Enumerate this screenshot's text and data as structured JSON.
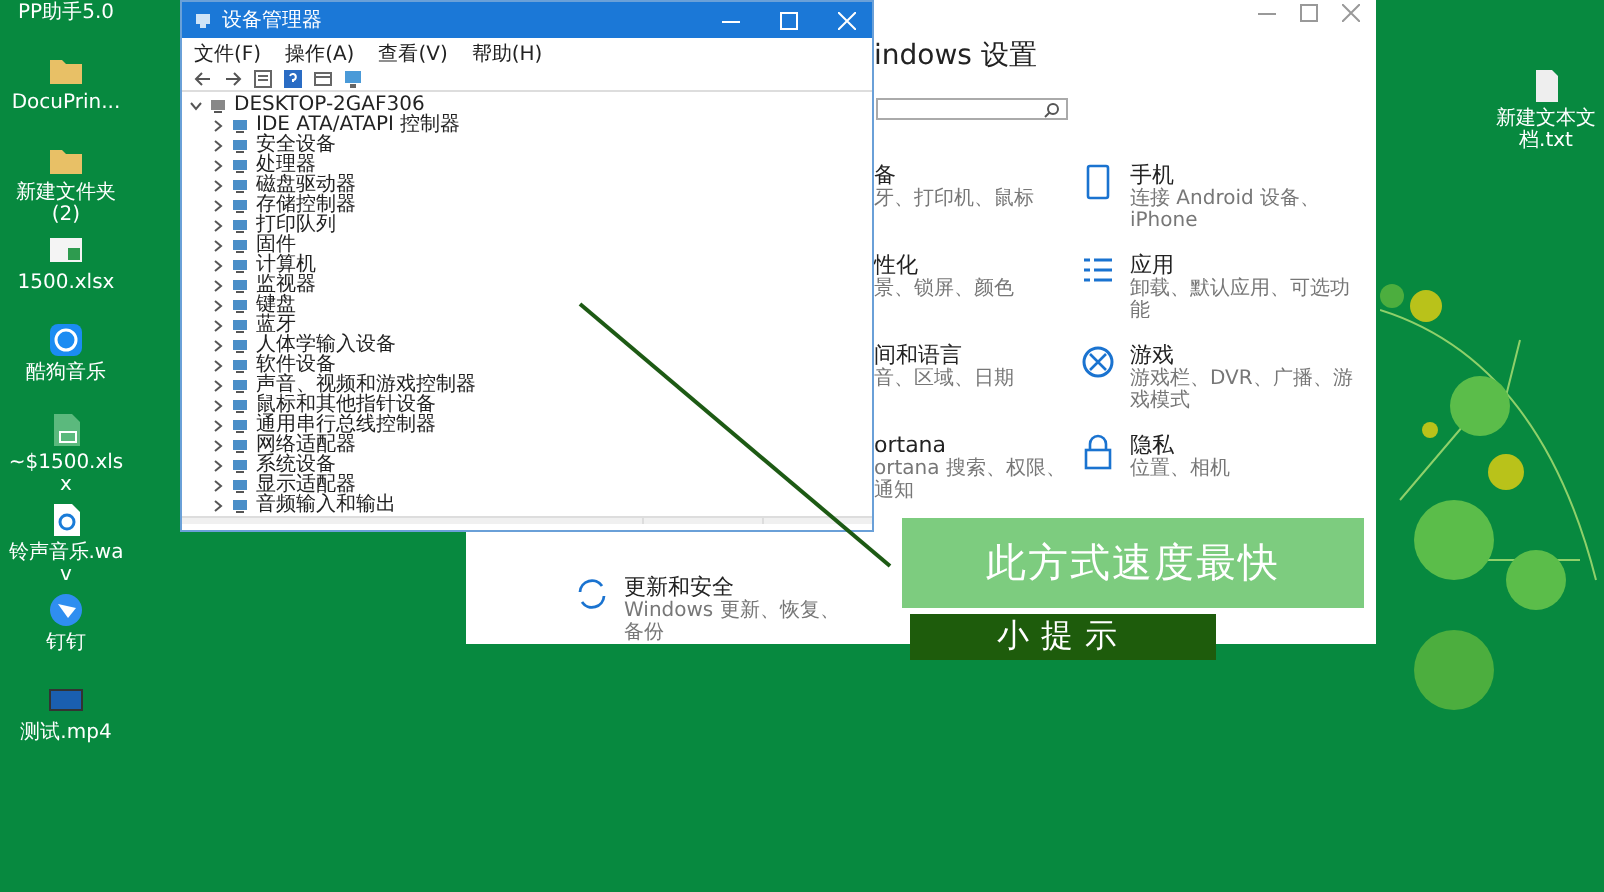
{
  "desktop_icons": [
    {
      "label": "PP助手5.0",
      "kind": "app"
    },
    {
      "label": "DocuPrin...",
      "kind": "folder"
    },
    {
      "label": "新建文件夹(2)",
      "kind": "folder"
    },
    {
      "label": "1500.xlsx",
      "kind": "sheet"
    },
    {
      "label": "酷狗音乐",
      "kind": "music"
    },
    {
      "label": "~$1500.xlsx",
      "kind": "excel"
    },
    {
      "label": "铃声音乐.wav",
      "kind": "audio"
    },
    {
      "label": "钉钉",
      "kind": "chat"
    },
    {
      "label": "测试.mp4",
      "kind": "video"
    }
  ],
  "desktop_icon_right": {
    "label": "新建文本文档.txt",
    "kind": "text"
  },
  "settings_window": {
    "title": "indows 设置",
    "tiles": [
      {
        "title": "备",
        "subtitle": "牙、打印机、鼠标",
        "kind": "covered"
      },
      {
        "title": "手机",
        "subtitle": "连接 Android 设备、iPhone",
        "kind": "phone"
      },
      {
        "title": "性化",
        "subtitle": "景、锁屏、颜色",
        "kind": "covered"
      },
      {
        "title": "应用",
        "subtitle": "卸载、默认应用、可选功能",
        "kind": "apps"
      },
      {
        "title": "间和语言",
        "subtitle": "音、区域、日期",
        "kind": "covered"
      },
      {
        "title": "游戏",
        "subtitle": "游戏栏、DVR、广播、游戏模式",
        "kind": "game"
      },
      {
        "title": "ortana",
        "subtitle": "ortana 搜索、权限、通知",
        "kind": "covered"
      },
      {
        "title": "隐私",
        "subtitle": "位置、相机",
        "kind": "privacy"
      }
    ],
    "bottom_tile": {
      "title": "更新和安全",
      "subtitle": "Windows 更新、恢复、备份",
      "kind": "update"
    }
  },
  "device_manager": {
    "title": "设备管理器",
    "menu": [
      "文件(F)",
      "操作(A)",
      "查看(V)",
      "帮助(H)"
    ],
    "tree": [
      {
        "label": "DESKTOP-2GAF306",
        "expanded": true,
        "children": [
          {
            "label": "IDE ATA/ATAPI 控制器",
            "expanded": false
          },
          {
            "label": "安全设备",
            "expanded": false
          },
          {
            "label": "处理器",
            "expanded": false
          },
          {
            "label": "磁盘驱动器",
            "expanded": false
          },
          {
            "label": "存储控制器",
            "expanded": false
          },
          {
            "label": "打印队列",
            "expanded": false
          },
          {
            "label": "固件",
            "expanded": false
          },
          {
            "label": "计算机",
            "expanded": false
          },
          {
            "label": "监视器",
            "expanded": false
          },
          {
            "label": "键盘",
            "expanded": false
          },
          {
            "label": "蓝牙",
            "expanded": false
          },
          {
            "label": "人体学输入设备",
            "expanded": false
          },
          {
            "label": "软件设备",
            "expanded": false
          },
          {
            "label": "声音、视频和游戏控制器",
            "expanded": false
          },
          {
            "label": "鼠标和其他指针设备",
            "expanded": false
          },
          {
            "label": "通用串行总线控制器",
            "expanded": false
          },
          {
            "label": "网络适配器",
            "expanded": false
          },
          {
            "label": "系统设备",
            "expanded": false
          },
          {
            "label": "显示适配器",
            "expanded": false
          },
          {
            "label": "音频输入和输出",
            "expanded": false
          }
        ]
      }
    ]
  },
  "captions": [
    {
      "text": "此方式速度最快",
      "kind": "highlight"
    },
    {
      "text": "小提示",
      "kind": "tag"
    }
  ]
}
